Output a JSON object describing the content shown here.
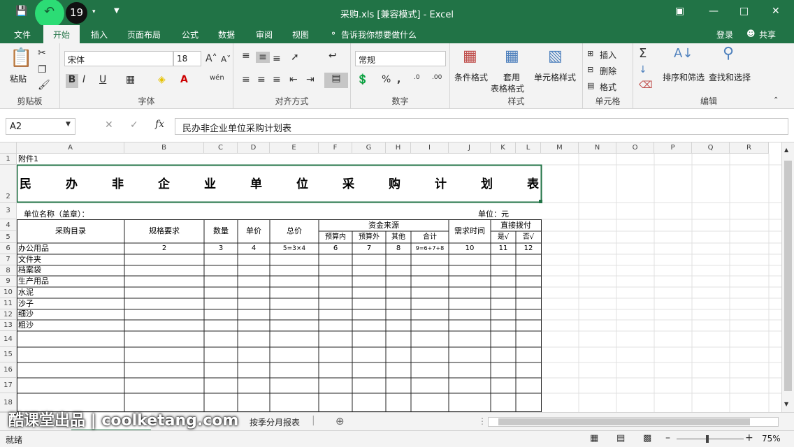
{
  "window": {
    "title": "采购.xls  [兼容模式] - Excel",
    "undo_count": "19"
  },
  "menu": {
    "tabs": [
      "文件",
      "开始",
      "插入",
      "页面布局",
      "公式",
      "数据",
      "审阅",
      "视图"
    ],
    "tell_me": "告诉我你想要做什么",
    "login": "登录",
    "share": "共享"
  },
  "ribbon": {
    "clipboard": {
      "label": "剪贴板",
      "paste": "粘贴"
    },
    "font": {
      "label": "字体",
      "name": "宋体",
      "size": "18",
      "bold": "B",
      "italic": "I",
      "underline": "U"
    },
    "align": {
      "label": "对齐方式"
    },
    "number": {
      "label": "数字",
      "format": "常规"
    },
    "styles": {
      "label": "样式",
      "cond": "条件格式",
      "table": "套用",
      "table2": "表格格式",
      "cell": "单元格样式"
    },
    "cells": {
      "label": "单元格",
      "insert": "插入",
      "delete": "删除",
      "format": "格式"
    },
    "edit": {
      "label": "编辑",
      "sort": "排序和筛选",
      "find": "查找和选择"
    }
  },
  "formula_bar": {
    "name_box": "A2",
    "formula": "民办非企业单位采购计划表"
  },
  "columns": [
    "A",
    "B",
    "C",
    "D",
    "E",
    "F",
    "G",
    "H",
    "I",
    "J",
    "K",
    "L",
    "M",
    "N",
    "O",
    "P",
    "Q",
    "R"
  ],
  "rows": [
    "1",
    "2",
    "3",
    "4",
    "5",
    "6",
    "7",
    "8",
    "9",
    "10",
    "11",
    "12",
    "13",
    "14",
    "15",
    "16",
    "17",
    "18"
  ],
  "sheet": {
    "a1": "附件1",
    "title_chars": [
      "民",
      "办",
      "非",
      "企",
      "业",
      "单",
      "位",
      "采",
      "购",
      "计",
      "划",
      "表"
    ],
    "unit_name": "单位名称（盖章）：",
    "unit": "单位：元",
    "headers": {
      "catalog": "采购目录",
      "spec": "规格要求",
      "qty": "数量",
      "price": "单价",
      "total": "总价",
      "fund": "资金来源",
      "in_budget": "预算内",
      "out_budget": "预算外",
      "other": "其他",
      "sum": "合计",
      "demand_time": "需求时间",
      "direct": "直接拨付",
      "yes": "是√",
      "no": "否√"
    },
    "row6": [
      "办公用品",
      "2",
      "3",
      "4",
      "5=3×4",
      "6",
      "7",
      "8",
      "9=6+7+8",
      "10",
      "11",
      "12"
    ],
    "items": [
      "文件夹",
      "档案袋",
      "生产用品",
      "水泥",
      "沙子",
      "细沙",
      "粗沙"
    ]
  },
  "tabs_bottom": {
    "sheet2": "按季分月报表"
  },
  "status": {
    "ready": "就绪",
    "zoom": "75%"
  },
  "watermark": "酷课堂出品 | coolketang.com"
}
